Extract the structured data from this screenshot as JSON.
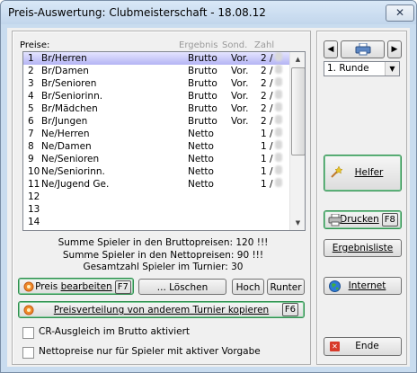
{
  "window": {
    "title": "Preis-Auswertung: Clubmeisterschaft - 18.08.12",
    "close_glyph": "✕"
  },
  "list": {
    "header_label": "Preise:",
    "columns": [
      "Ergebnis",
      "Sond.",
      "Zahl"
    ],
    "rows": [
      {
        "num": "1",
        "name": "Br/Herren",
        "result": "Brutto",
        "special": "Vor.",
        "count": "2 /"
      },
      {
        "num": "2",
        "name": "Br/Damen",
        "result": "Brutto",
        "special": "Vor.",
        "count": "2 /"
      },
      {
        "num": "3",
        "name": "Br/Senioren",
        "result": "Brutto",
        "special": "Vor.",
        "count": "2 /"
      },
      {
        "num": "4",
        "name": "Br/Seniorinn.",
        "result": "Brutto",
        "special": "Vor.",
        "count": "2 /"
      },
      {
        "num": "5",
        "name": "Br/Mädchen",
        "result": "Brutto",
        "special": "Vor.",
        "count": "2 /"
      },
      {
        "num": "6",
        "name": "Br/Jungen",
        "result": "Brutto",
        "special": "Vor.",
        "count": "2 /"
      },
      {
        "num": "7",
        "name": "Ne/Herren",
        "result": "Netto",
        "special": "",
        "count": "1 /"
      },
      {
        "num": "8",
        "name": "Ne/Damen",
        "result": "Netto",
        "special": "",
        "count": "1 /"
      },
      {
        "num": "9",
        "name": "Ne/Senioren",
        "result": "Netto",
        "special": "",
        "count": "1 /"
      },
      {
        "num": "10",
        "name": "Ne/Seniorinn.",
        "result": "Netto",
        "special": "",
        "count": "1 /"
      },
      {
        "num": "11",
        "name": "Ne/Jugend Ge.",
        "result": "Netto",
        "special": "",
        "count": "1 /"
      },
      {
        "num": "12",
        "name": "",
        "result": "",
        "special": "",
        "count": ""
      },
      {
        "num": "13",
        "name": "",
        "result": "",
        "special": "",
        "count": ""
      },
      {
        "num": "14",
        "name": "",
        "result": "",
        "special": "",
        "count": ""
      }
    ],
    "selected_index": 0
  },
  "summary": {
    "brutto": "Summe Spieler in den Bruttopreisen: 120 !!!",
    "netto": "Summe Spieler in den Nettopreisen: 90 !!!",
    "total": "Gesamtzahl Spieler im Turnier: 30"
  },
  "buttons": {
    "edit_pre": "Preis ",
    "edit_u": "bearbeiten",
    "edit_key": "F7",
    "delete": "... Löschen",
    "up": "Hoch",
    "down": "Runter",
    "copy_u": "Preisverteilung von anderem Turnier kopieren",
    "copy_key": "F6"
  },
  "checkboxes": {
    "cr_label": "CR-Ausgleich im Brutto aktiviert",
    "cr_checked": false,
    "net_label": "Nettopreise nur für Spieler mit aktiver Vorgabe",
    "net_checked": false
  },
  "side": {
    "prev_glyph": "◀",
    "next_glyph": "▶",
    "round_value": "1. Runde",
    "round_arrow": "▼",
    "helper_label": "Helfer",
    "print_label": "Drucken",
    "print_key": "F8",
    "results_label": "Ergebnisliste",
    "internet_label": "Internet",
    "end_label": "Ende",
    "end_icon_glyph": "✕"
  },
  "scrollbar": {
    "up_glyph": "▲",
    "down_glyph": "▼"
  },
  "colors": {
    "selection": "#b4b4f4",
    "window_frame": "#c9dcef",
    "focus_green": "#2f8f4f"
  }
}
